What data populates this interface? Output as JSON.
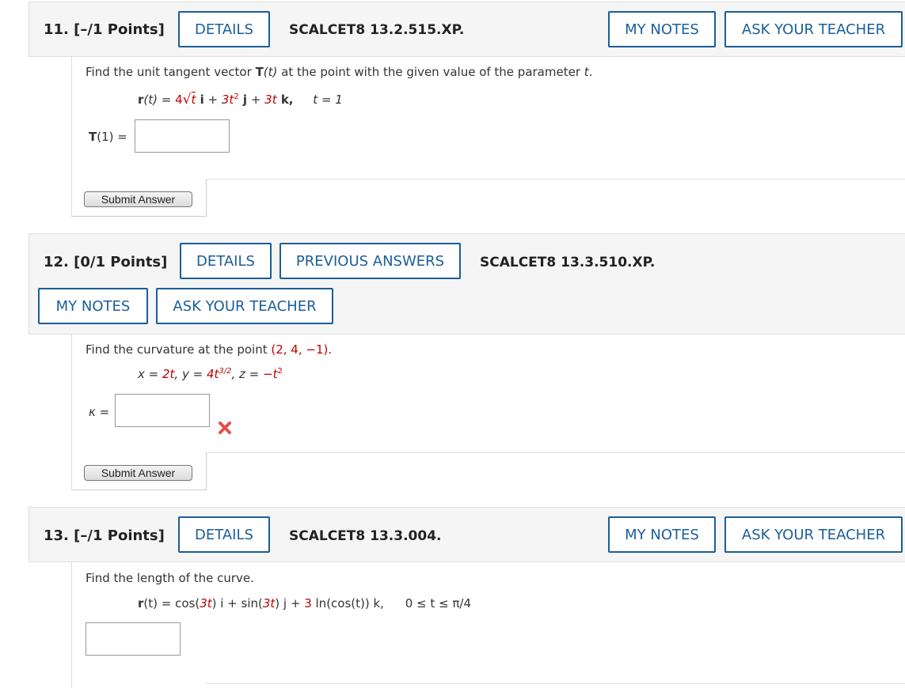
{
  "q11": {
    "number": "11.",
    "points": "[–/1 Points]",
    "details": "DETAILS",
    "code": "SCALCET8 13.2.515.XP.",
    "my_notes": "MY NOTES",
    "ask_teacher": "ASK YOUR TEACHER",
    "prompt_pre": "Find the unit tangent vector ",
    "prompt_T": "T",
    "prompt_t1": "(t)",
    "prompt_mid": " at the point with the given value of the parameter ",
    "prompt_t2": "t",
    "prompt_end": ".",
    "eq_r": "r",
    "eq_lhs": "(t) = ",
    "eq_4": "4",
    "eq_t_sqrt": "t",
    "eq_i": " i",
    "eq_plus1": " + ",
    "eq_3t2": "3t",
    "eq_sup2": "2",
    "eq_j": " j",
    "eq_plus2": " + ",
    "eq_3t": "3t",
    "eq_k": " k,",
    "eq_param": "t = 1",
    "answer_label_T": "T",
    "answer_label_rest": "(1) =",
    "answer_value": "",
    "submit": "Submit Answer"
  },
  "q12": {
    "number": "12.",
    "points": "[0/1 Points]",
    "details": "DETAILS",
    "previous_answers": "PREVIOUS ANSWERS",
    "code": "SCALCET8 13.3.510.XP.",
    "my_notes": "MY NOTES",
    "ask_teacher": "ASK YOUR TEACHER",
    "prompt_pre": "Find the curvature at the point ",
    "point": "(2, 4, −1)",
    "prompt_end": ".",
    "eq_x": "x = ",
    "eq_2t": "2t",
    "eq_y": ",  y = ",
    "eq_4t": "4t",
    "eq_sup32": "3/2",
    "eq_z": ",  z = ",
    "eq_negt": "−t",
    "eq_sup2": "2",
    "answer_label": "κ =",
    "answer_value": "",
    "status": "incorrect",
    "submit": "Submit Answer",
    "colors": {
      "incorrect": "#e05050"
    }
  },
  "q13": {
    "number": "13.",
    "points": "[–/1 Points]",
    "details": "DETAILS",
    "code": "SCALCET8 13.3.004.",
    "my_notes": "MY NOTES",
    "ask_teacher": "ASK YOUR TEACHER",
    "prompt": "Find the length of the curve.",
    "eq_r": "r",
    "eq_lhs": "(t) = cos(",
    "eq_3t_a": "3t",
    "eq_mid1": ") i + sin(",
    "eq_3t_b": "3t",
    "eq_mid2": ") j + ",
    "eq_3": "3",
    "eq_ln": " ln(cos(t)) k,",
    "eq_range": "0 ≤ t ≤ π/4",
    "answer_value": ""
  },
  "colors": {
    "accent": "#1a5e9a",
    "header_bg": "#f5f5f5",
    "highlight": "#c00000"
  }
}
